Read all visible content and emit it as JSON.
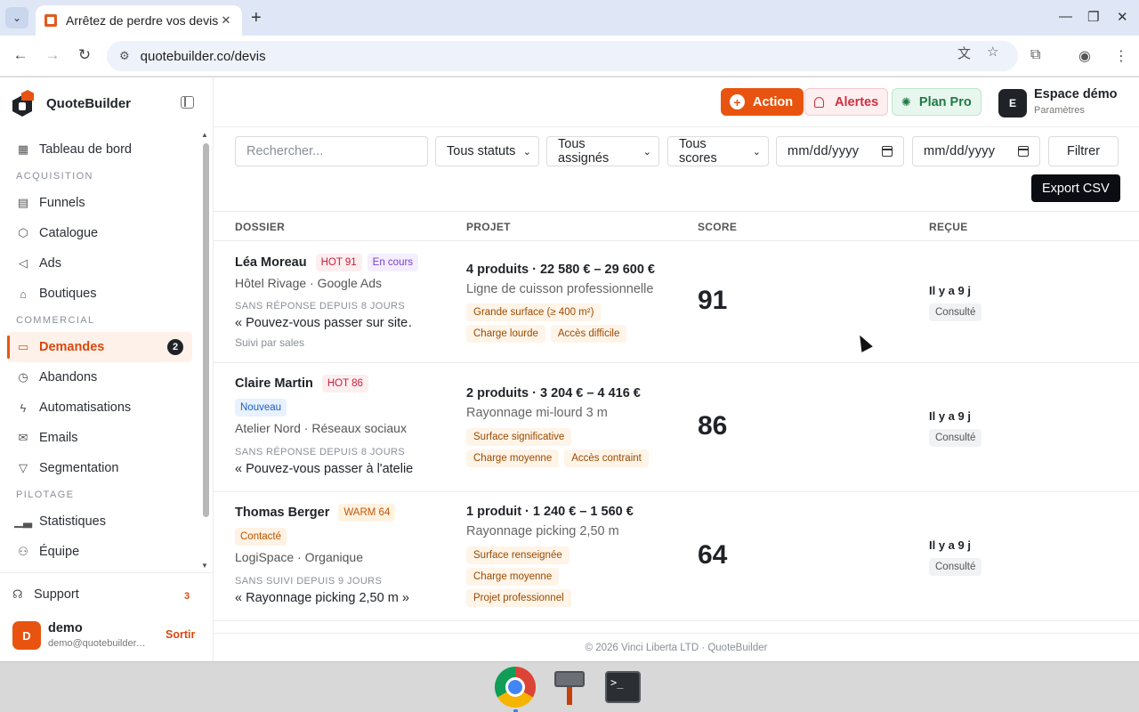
{
  "browser": {
    "tab_title": "Arrêtez de perdre vos devis",
    "url": "quotebuilder.co/devis"
  },
  "brand": {
    "name": "QuoteBuilder"
  },
  "sidebar": {
    "items": [
      {
        "label": "Tableau de bord",
        "icon": "dashboard-icon"
      },
      {
        "section": "ACQUISITION"
      },
      {
        "label": "Funnels",
        "icon": "funnel-layout-icon"
      },
      {
        "label": "Catalogue",
        "icon": "box-icon"
      },
      {
        "label": "Ads",
        "icon": "megaphone-icon"
      },
      {
        "label": "Boutiques",
        "icon": "store-icon"
      },
      {
        "section": "COMMERCIAL"
      },
      {
        "label": "Demandes",
        "icon": "inbox-icon",
        "active": true,
        "badge": "2"
      },
      {
        "label": "Abandons",
        "icon": "clock-icon"
      },
      {
        "label": "Automatisations",
        "icon": "bolt-icon"
      },
      {
        "label": "Emails",
        "icon": "mail-icon"
      },
      {
        "label": "Segmentation",
        "icon": "filter-icon"
      },
      {
        "section": "PILOTAGE"
      },
      {
        "label": "Statistiques",
        "icon": "bar-chart-icon"
      },
      {
        "label": "Équipe",
        "icon": "team-icon"
      }
    ],
    "support": {
      "label": "Support",
      "count": "3"
    },
    "user": {
      "initial": "D",
      "name": "demo",
      "email": "demo@quotebuilder.co",
      "logout": "Sortir"
    }
  },
  "topbar": {
    "action_label": "Action",
    "alerts_label": "Alertes",
    "plan_label": "Plan Pro",
    "workspace_initial": "E",
    "workspace_name": "Espace démo",
    "workspace_sub": "Paramètres"
  },
  "filters": {
    "search_placeholder": "Rechercher...",
    "status": "Tous statuts",
    "assignee": "Tous assignés",
    "score": "Tous scores",
    "date_from": "mm/dd/yyyy",
    "date_to": "mm/dd/yyyy",
    "filter_label": "Filtrer",
    "export_label": "Export CSV"
  },
  "table": {
    "headers": {
      "dossier": "DOSSIER",
      "projet": "PROJET",
      "score": "SCORE",
      "recue": "REÇUE"
    },
    "rows": [
      {
        "client": "Léa Moreau",
        "lead_badge": "HOT 91",
        "status": "En cours",
        "company": "Hôtel Rivage · Google Ads",
        "since": "SANS RÉPONSE DEPUIS 8 JOURS",
        "quote": "« Pouvez-vous passer sur site…",
        "followup": "Suivi par sales",
        "project_summary": "4 produits · 22 580 € – 29 600 €",
        "project_name": "Ligne de cuisson professionnelle",
        "tags": [
          "Grande surface (≥ 400 m²)",
          "Charge lourde",
          "Accès difficile"
        ],
        "score": "91",
        "received": "Il y a 9 j",
        "view_status": "Consulté"
      },
      {
        "client": "Claire Martin",
        "lead_badge": "HOT 86",
        "status": "Nouveau",
        "company": "Atelier Nord · Réseaux sociaux",
        "since": "SANS RÉPONSE DEPUIS 8 JOURS",
        "quote": "« Pouvez-vous passer à l'atelier…",
        "project_summary": "2 produits · 3 204 € – 4 416 €",
        "project_name": "Rayonnage mi-lourd 3 m",
        "tags": [
          "Surface significative",
          "Charge moyenne",
          "Accès contraint"
        ],
        "score": "86",
        "received": "Il y a 9 j",
        "view_status": "Consulté"
      },
      {
        "client": "Thomas Berger",
        "lead_badge": "WARM 64",
        "status": "Contacté",
        "company": "LogiSpace · Organique",
        "since": "SANS SUIVI DEPUIS 9 JOURS",
        "quote": "« Rayonnage picking 2,50 m »",
        "project_summary": "1 produit · 1 240 € – 1 560 €",
        "project_name": "Rayonnage picking 2,50 m",
        "tags": [
          "Surface renseignée",
          "Charge moyenne",
          "Projet professionnel"
        ],
        "score": "64",
        "received": "Il y a 9 j",
        "view_status": "Consulté"
      }
    ]
  },
  "footer": {
    "text": "© 2026 Vinci Liberta LTD · QuoteBuilder"
  },
  "colors": {
    "accent": "#e8540f",
    "dark": "#1f2328",
    "alert": "#d03040",
    "plan": "#1e7a44"
  }
}
